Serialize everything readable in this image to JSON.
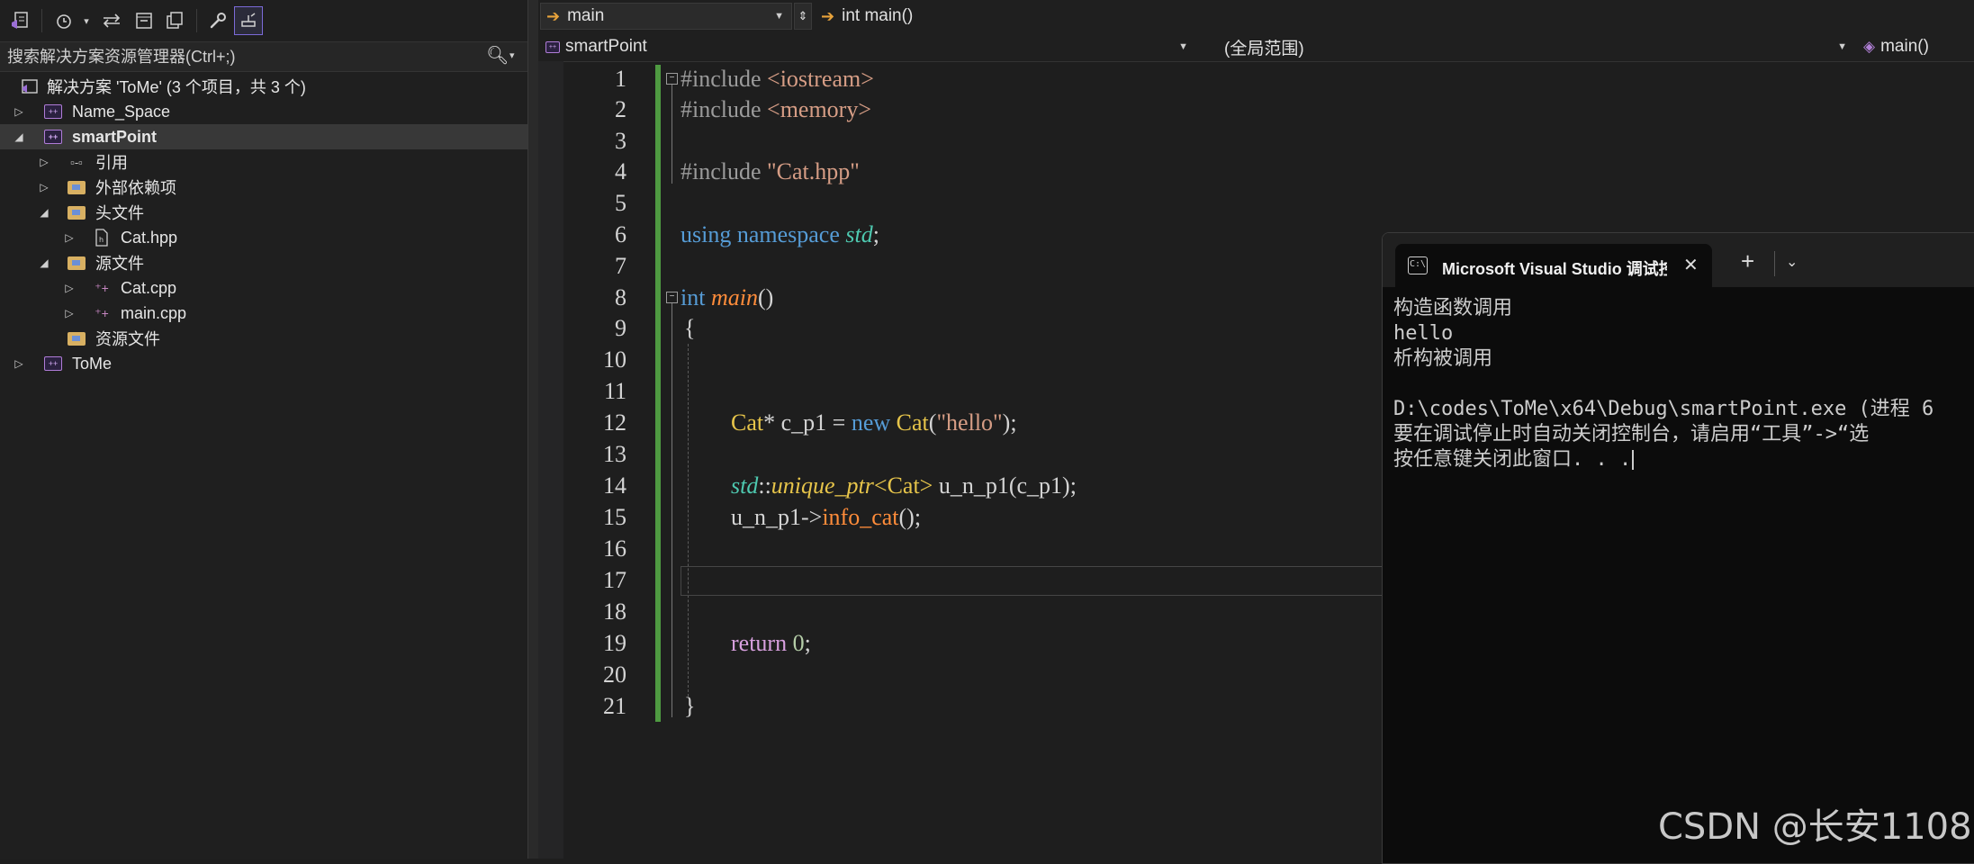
{
  "solution_explorer": {
    "search": {
      "placeholder": "搜索解决方案资源管理器(Ctrl+;)"
    },
    "toolbar": {
      "items": [
        "vs-project-icon",
        "history-icon",
        "dropdown-caret-icon",
        "sync-icon",
        "collapse-all-icon",
        "show-all-files-icon",
        "properties-wrench-icon",
        "preview-selected-icon"
      ]
    },
    "tree": {
      "solution_label": "解决方案 'ToMe' (3 个项目，共 3 个)",
      "project_name_space": "Name_Space",
      "project_smartpoint": "smartPoint",
      "references": "引用",
      "external_deps": "外部依赖项",
      "header_files": "头文件",
      "cat_hpp": "Cat.hpp",
      "source_files": "源文件",
      "cat_cpp": "Cat.cpp",
      "main_cpp": "main.cpp",
      "resource_files": "资源文件",
      "project_tome": "ToMe"
    }
  },
  "editor": {
    "nav": {
      "scope_dropdown": "main",
      "function_dropdown": "int main()",
      "project_dropdown": "smartPoint",
      "global_scope": "(全局范围)",
      "member_dropdown": "main()"
    },
    "line_numbers": [
      "1",
      "2",
      "3",
      "4",
      "5",
      "6",
      "7",
      "8",
      "9",
      "10",
      "11",
      "12",
      "13",
      "14",
      "15",
      "16",
      "17",
      "18",
      "19",
      "20",
      "21"
    ],
    "code": {
      "l1_directive": "#include",
      "l1_header": "<iostream>",
      "l2_directive": "#include",
      "l2_header": "<memory>",
      "l4_directive": "#include",
      "l4_header": "\"Cat.hpp\"",
      "l6_using": "using",
      "l6_namespace": "namespace",
      "l6_std": "std",
      "l6_semi": ";",
      "l8_int": "int",
      "l8_main": "main",
      "l8_parens": "()",
      "l9_brace": "{",
      "l12_type": "Cat",
      "l12_star": "*",
      "l12_var": "c_p1",
      "l12_eq": "=",
      "l12_new": "new",
      "l12_ctor": "Cat",
      "l12_open": "(",
      "l12_arg": "\"hello\"",
      "l12_close": ");",
      "l14_std": "std",
      "l14_scope": "::",
      "l14_uptr": "unique_ptr",
      "l14_targ": "<Cat>",
      "l14_var": "u_n_p1",
      "l14_arg": "(c_p1);",
      "l15_var": "u_n_p1",
      "l15_arrow": "->",
      "l15_fn": "info_cat",
      "l15_end": "();",
      "l19_return": "return",
      "l19_zero": "0",
      "l19_semi": ";",
      "l21_brace": "}"
    }
  },
  "console": {
    "tab_title": "Microsoft Visual Studio 调试控制台",
    "lines": [
      "构造函数调用",
      "hello",
      "析构被调用",
      "",
      "D:\\codes\\ToMe\\x64\\Debug\\smartPoint.exe (进程 6",
      "要在调试停止时自动关闭控制台，请启用“工具”->“选",
      "按任意键关闭此窗口. . ."
    ]
  },
  "watermark": "CSDN @长安1108"
}
